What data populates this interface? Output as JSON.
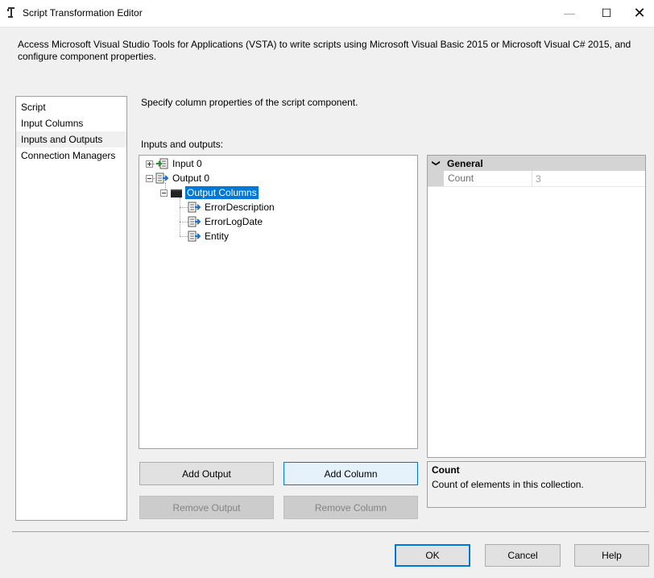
{
  "window": {
    "title": "Script Transformation Editor",
    "min_glyph": "—",
    "max_glyph": "☐",
    "close_glyph": "✕",
    "icon": "script-component-icon"
  },
  "description": "Access Microsoft Visual Studio Tools for Applications (VSTA) to write scripts using Microsoft Visual Basic 2015 or Microsoft Visual C# 2015, and configure component properties.",
  "nav": {
    "items": [
      {
        "label": "Script"
      },
      {
        "label": "Input Columns"
      },
      {
        "label": "Inputs and Outputs",
        "selected": true
      },
      {
        "label": "Connection Managers"
      }
    ]
  },
  "main": {
    "specify_text": "Specify column properties of the script component.",
    "io_label": "Inputs and outputs:"
  },
  "tree": {
    "input": "Input 0",
    "output": "Output 0",
    "output_columns": "Output Columns",
    "columns": [
      "ErrorDescription",
      "ErrorLogDate",
      "Entity"
    ]
  },
  "properties": {
    "category": "General",
    "chevron": "❯",
    "rows": [
      {
        "name": "Count",
        "value": "3"
      }
    ],
    "help_title": "Count",
    "help_desc": "Count of elements in this collection."
  },
  "buttons": {
    "add_output": "Add Output",
    "add_column": "Add Column",
    "remove_output": "Remove Output",
    "remove_column": "Remove Column",
    "ok": "OK",
    "cancel": "Cancel",
    "help": "Help"
  },
  "colors": {
    "accent": "#0078d7",
    "window_bg": "#f0f0f0"
  }
}
